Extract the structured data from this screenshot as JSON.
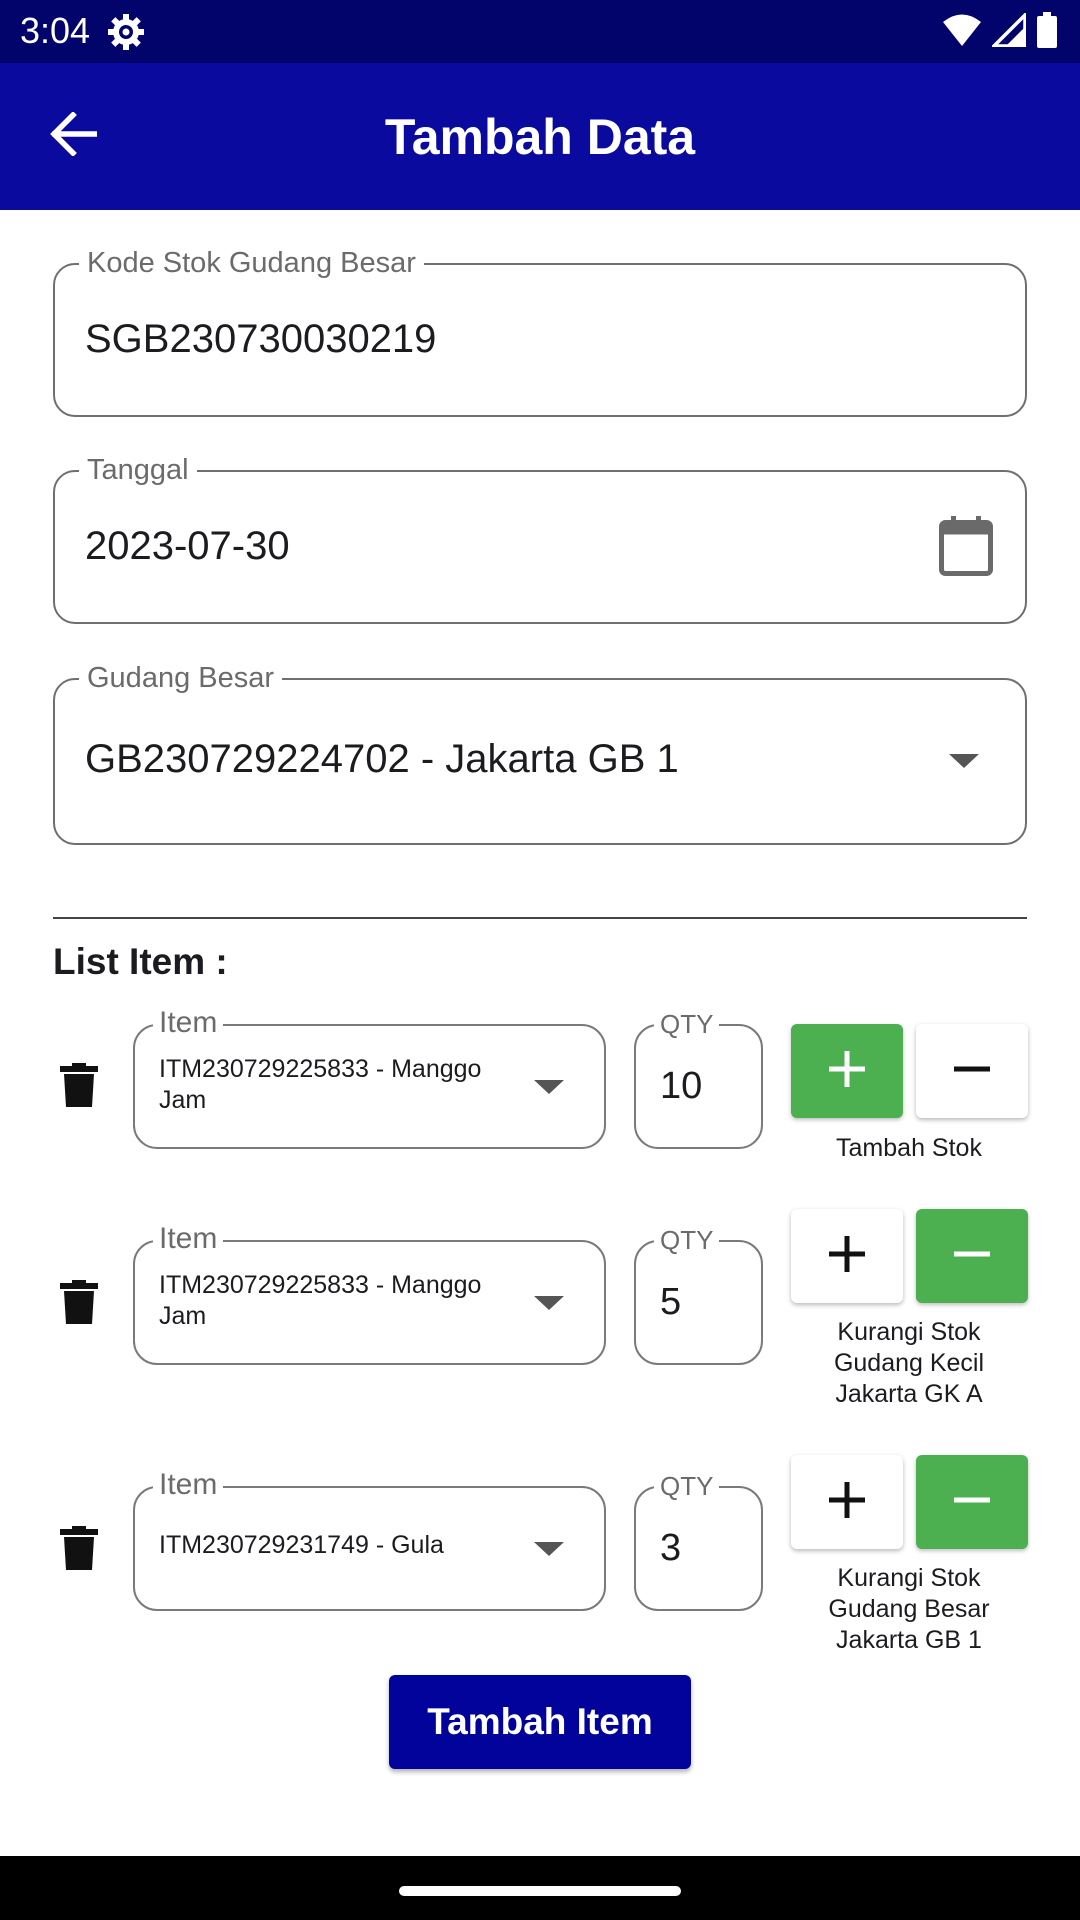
{
  "status_bar": {
    "time": "3:04",
    "icons": [
      "settings-icon",
      "wifi-icon",
      "signal-icon",
      "battery-icon"
    ]
  },
  "app_bar": {
    "title": "Tambah Data",
    "back_icon": "arrow-back-icon"
  },
  "form": {
    "kode_stok": {
      "label": "Kode Stok Gudang Besar",
      "value": "SGB230730030219"
    },
    "tanggal": {
      "label": "Tanggal",
      "value": "2023-07-30",
      "icon": "calendar-icon"
    },
    "gudang_besar": {
      "label": "Gudang Besar",
      "value": "GB230729224702 - Jakarta GB 1",
      "icon": "dropdown-arrow-icon"
    }
  },
  "list_title": "List Item :",
  "items": [
    {
      "item_label": "Item",
      "item_value": "ITM230729225833 - Manggo Jam",
      "qty_label": "QTY",
      "qty": "10",
      "selected_op": "add",
      "caption": "Tambah Stok"
    },
    {
      "item_label": "Item",
      "item_value": "ITM230729225833 - Manggo Jam",
      "qty_label": "QTY",
      "qty": "5",
      "selected_op": "subtract",
      "caption": "Kurangi Stok Gudang Kecil Jakarta GK A"
    },
    {
      "item_label": "Item",
      "item_value": "ITM230729231749 - Gula",
      "qty_label": "QTY",
      "qty": "3",
      "selected_op": "subtract",
      "caption": "Kurangi Stok Gudang Besar Jakarta GB 1"
    }
  ],
  "add_item_button": "Tambah Item",
  "colors": {
    "status_bar": "#02036b",
    "app_bar": "#0a0a9e",
    "active_op": "#4caf50",
    "primary_button": "#02039b"
  }
}
